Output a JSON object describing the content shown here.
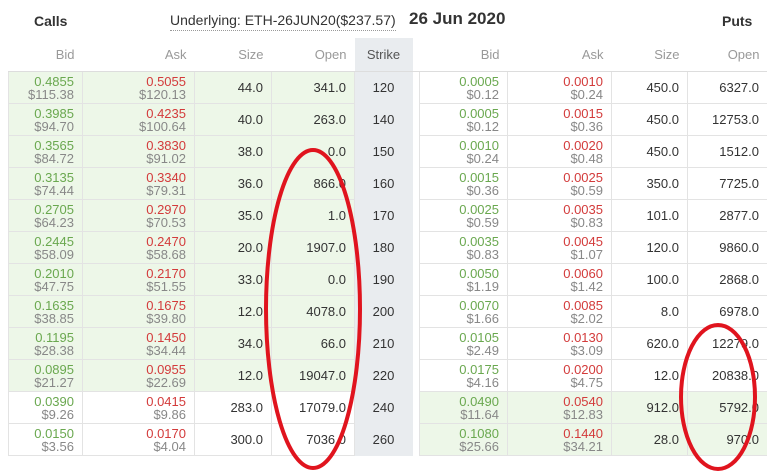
{
  "header": {
    "calls_label": "Calls",
    "underlying": "Underlying: ETH-26JUN20($237.57)",
    "date": "26 Jun 2020",
    "puts_label": "Puts"
  },
  "columns": {
    "calls": [
      "Bid",
      "Ask",
      "Size",
      "Open"
    ],
    "strike": "Strike",
    "puts": [
      "Bid",
      "Ask",
      "Size",
      "Open"
    ]
  },
  "colors": {
    "itm_bg": "#edf7e8",
    "bid": "#6aa84f",
    "ask": "#d33b3b",
    "annotation": "#e0141e"
  },
  "rows": [
    {
      "strike": "120",
      "calls_itm": true,
      "puts_itm": false,
      "call": {
        "bid": "0.4855",
        "bid_usd": "$115.38",
        "ask": "0.5055",
        "ask_usd": "$120.13",
        "size": "44.0",
        "open": "341.0"
      },
      "put": {
        "bid": "0.0005",
        "bid_usd": "$0.12",
        "ask": "0.0010",
        "ask_usd": "$0.24",
        "size": "450.0",
        "open": "6327.0"
      }
    },
    {
      "strike": "140",
      "calls_itm": true,
      "puts_itm": false,
      "call": {
        "bid": "0.3985",
        "bid_usd": "$94.70",
        "ask": "0.4235",
        "ask_usd": "$100.64",
        "size": "40.0",
        "open": "263.0"
      },
      "put": {
        "bid": "0.0005",
        "bid_usd": "$0.12",
        "ask": "0.0015",
        "ask_usd": "$0.36",
        "size": "450.0",
        "open": "12753.0"
      }
    },
    {
      "strike": "150",
      "calls_itm": true,
      "puts_itm": false,
      "call": {
        "bid": "0.3565",
        "bid_usd": "$84.72",
        "ask": "0.3830",
        "ask_usd": "$91.02",
        "size": "38.0",
        "open": "0.0"
      },
      "put": {
        "bid": "0.0010",
        "bid_usd": "$0.24",
        "ask": "0.0020",
        "ask_usd": "$0.48",
        "size": "450.0",
        "open": "1512.0"
      }
    },
    {
      "strike": "160",
      "calls_itm": true,
      "puts_itm": false,
      "call": {
        "bid": "0.3135",
        "bid_usd": "$74.44",
        "ask": "0.3340",
        "ask_usd": "$79.31",
        "size": "36.0",
        "open": "866.0"
      },
      "put": {
        "bid": "0.0015",
        "bid_usd": "$0.36",
        "ask": "0.0025",
        "ask_usd": "$0.59",
        "size": "350.0",
        "open": "7725.0"
      }
    },
    {
      "strike": "170",
      "calls_itm": true,
      "puts_itm": false,
      "call": {
        "bid": "0.2705",
        "bid_usd": "$64.23",
        "ask": "0.2970",
        "ask_usd": "$70.53",
        "size": "35.0",
        "open": "1.0"
      },
      "put": {
        "bid": "0.0025",
        "bid_usd": "$0.59",
        "ask": "0.0035",
        "ask_usd": "$0.83",
        "size": "101.0",
        "open": "2877.0"
      }
    },
    {
      "strike": "180",
      "calls_itm": true,
      "puts_itm": false,
      "call": {
        "bid": "0.2445",
        "bid_usd": "$58.09",
        "ask": "0.2470",
        "ask_usd": "$58.68",
        "size": "20.0",
        "open": "1907.0"
      },
      "put": {
        "bid": "0.0035",
        "bid_usd": "$0.83",
        "ask": "0.0045",
        "ask_usd": "$1.07",
        "size": "120.0",
        "open": "9860.0"
      }
    },
    {
      "strike": "190",
      "calls_itm": true,
      "puts_itm": false,
      "call": {
        "bid": "0.2010",
        "bid_usd": "$47.75",
        "ask": "0.2170",
        "ask_usd": "$51.55",
        "size": "33.0",
        "open": "0.0"
      },
      "put": {
        "bid": "0.0050",
        "bid_usd": "$1.19",
        "ask": "0.0060",
        "ask_usd": "$1.42",
        "size": "100.0",
        "open": "2868.0"
      }
    },
    {
      "strike": "200",
      "calls_itm": true,
      "puts_itm": false,
      "call": {
        "bid": "0.1635",
        "bid_usd": "$38.85",
        "ask": "0.1675",
        "ask_usd": "$39.80",
        "size": "12.0",
        "open": "4078.0"
      },
      "put": {
        "bid": "0.0070",
        "bid_usd": "$1.66",
        "ask": "0.0085",
        "ask_usd": "$2.02",
        "size": "8.0",
        "open": "6978.0"
      }
    },
    {
      "strike": "210",
      "calls_itm": true,
      "puts_itm": false,
      "call": {
        "bid": "0.1195",
        "bid_usd": "$28.38",
        "ask": "0.1450",
        "ask_usd": "$34.44",
        "size": "34.0",
        "open": "66.0"
      },
      "put": {
        "bid": "0.0105",
        "bid_usd": "$2.49",
        "ask": "0.0130",
        "ask_usd": "$3.09",
        "size": "620.0",
        "open": "12279.0"
      }
    },
    {
      "strike": "220",
      "calls_itm": true,
      "puts_itm": false,
      "call": {
        "bid": "0.0895",
        "bid_usd": "$21.27",
        "ask": "0.0955",
        "ask_usd": "$22.69",
        "size": "12.0",
        "open": "19047.0"
      },
      "put": {
        "bid": "0.0175",
        "bid_usd": "$4.16",
        "ask": "0.0200",
        "ask_usd": "$4.75",
        "size": "12.0",
        "open": "20838.0"
      }
    },
    {
      "strike": "240",
      "calls_itm": false,
      "puts_itm": true,
      "call": {
        "bid": "0.0390",
        "bid_usd": "$9.26",
        "ask": "0.0415",
        "ask_usd": "$9.86",
        "size": "283.0",
        "open": "17079.0"
      },
      "put": {
        "bid": "0.0490",
        "bid_usd": "$11.64",
        "ask": "0.0540",
        "ask_usd": "$12.83",
        "size": "912.0",
        "open": "5792.0"
      }
    },
    {
      "strike": "260",
      "calls_itm": false,
      "puts_itm": true,
      "call": {
        "bid": "0.0150",
        "bid_usd": "$3.56",
        "ask": "0.0170",
        "ask_usd": "$4.04",
        "size": "300.0",
        "open": "7036.0"
      },
      "put": {
        "bid": "0.1080",
        "bid_usd": "$25.66",
        "ask": "0.1440",
        "ask_usd": "$34.21",
        "size": "28.0",
        "open": "970.0"
      }
    }
  ]
}
